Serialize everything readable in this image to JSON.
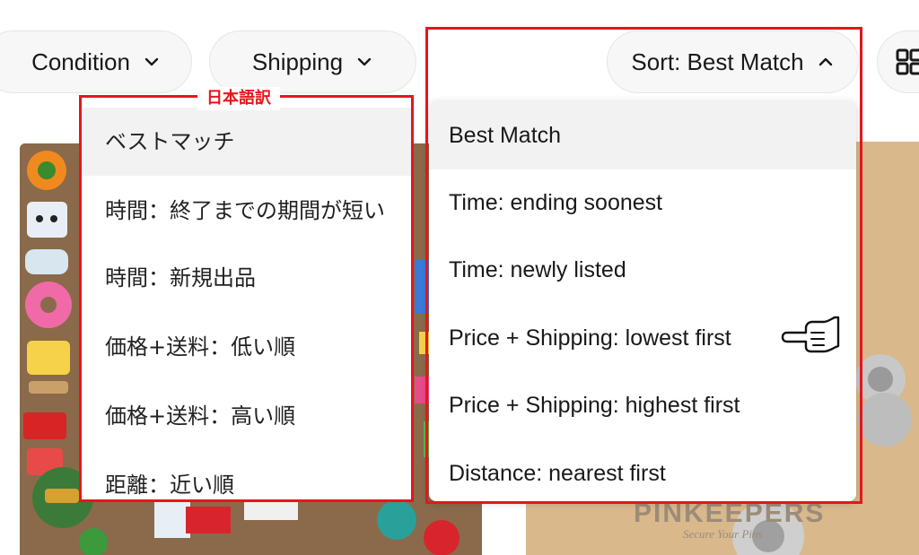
{
  "filters": {
    "condition_label": "Condition",
    "shipping_label": "Shipping",
    "sort_label": "Sort: Best Match"
  },
  "translation": {
    "tag": "日本語訳",
    "items": [
      {
        "label": "ベストマッチ",
        "selected": true
      },
      {
        "label": "時間：終了までの期間が短い"
      },
      {
        "label": "時間：新規出品"
      },
      {
        "label": "価格+送料：低い順"
      },
      {
        "label": "価格+送料：高い順"
      },
      {
        "label": "距離：近い順"
      }
    ]
  },
  "sort_menu": {
    "items": [
      {
        "label": "Best Match",
        "selected": true
      },
      {
        "label": "Time: ending soonest"
      },
      {
        "label": "Time: newly listed"
      },
      {
        "label": "Price + Shipping: lowest first"
      },
      {
        "label": "Price + Shipping: highest first"
      },
      {
        "label": "Distance: nearest first"
      }
    ]
  },
  "products": {
    "right_watermark": "PINKEEPERS",
    "right_watermark_sub": "Secure Your Pins"
  },
  "colors": {
    "highlight_red": "#e8141c",
    "selected_bg": "#f2f2f2",
    "pill_bg": "#f7f7f7"
  },
  "icons": {
    "dropdown": "chevron-down-icon",
    "sort_open": "chevron-up-icon",
    "view_toggle": "grid-view-icon",
    "pointer": "pointing-hand-icon"
  }
}
